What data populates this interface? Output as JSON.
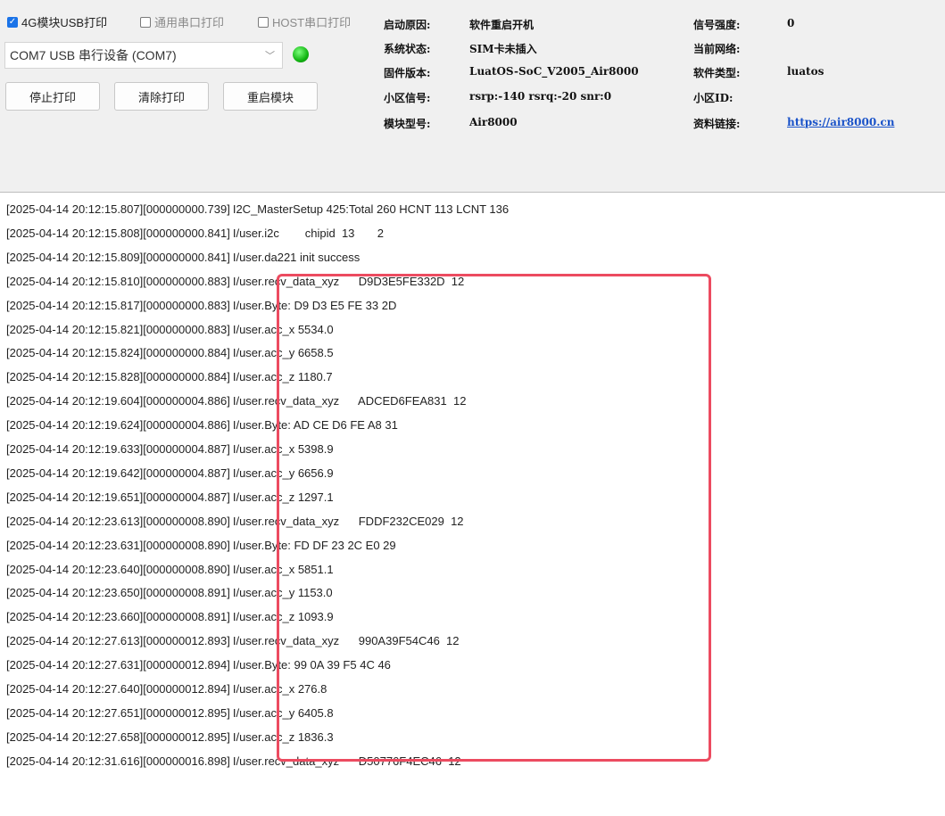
{
  "toolbar": {
    "checkbox_4g_usb": "4G模块USB打印",
    "checkbox_general_serial": "通用串口打印",
    "checkbox_host_serial": "HOST串口打印",
    "port_select": "COM7 USB 串行设备 (COM7)",
    "stop_button": "停止打印",
    "clear_button": "清除打印",
    "restart_button": "重启模块"
  },
  "device_info": {
    "boot_reason_label": "启动原因:",
    "boot_reason_value": "软件重启开机",
    "system_state_label": "系统状态:",
    "system_state_value": "SIM卡未插入",
    "firmware_label": "固件版本:",
    "firmware_value": "LuatOS-SoC_V2005_Air8000",
    "cell_signal_label": "小区信号:",
    "cell_signal_value": "rsrp:-140 rsrq:-20 snr:0",
    "module_model_label": "模块型号:",
    "module_model_value": "Air8000",
    "signal_strength_label": "信号强度:",
    "signal_strength_value": "0",
    "current_network_label": "当前网络:",
    "current_network_value": "",
    "software_type_label": "软件类型:",
    "software_type_value": "luatos",
    "cell_id_label": "小区ID:",
    "cell_id_value": "",
    "resource_link_label": "资料链接:",
    "resource_link_value": "https://air8000.cn"
  },
  "log": [
    {
      "prefix": "[2025-04-14 20:12:15.807][000000000.739]",
      "msg": "I2C_MasterSetup 425:Total 260 HCNT 113 LCNT 136"
    },
    {
      "prefix": "[2025-04-14 20:12:15.808][000000000.841]",
      "msg": "I/user.i2c        chipid  13       2"
    },
    {
      "prefix": "[2025-04-14 20:12:15.809][000000000.841]",
      "msg": "I/user.da221 init success"
    },
    {
      "prefix": "[2025-04-14 20:12:15.810][000000000.883]",
      "msg": "I/user.recv_data_xyz      D9D3E5FE332D  12"
    },
    {
      "prefix": "[2025-04-14 20:12:15.817][000000000.883]",
      "msg": "I/user.Byte: D9 D3 E5 FE 33 2D"
    },
    {
      "prefix": "[2025-04-14 20:12:15.821][000000000.883]",
      "msg": "I/user.acc_x 5534.0"
    },
    {
      "prefix": "[2025-04-14 20:12:15.824][000000000.884]",
      "msg": "I/user.acc_y 6658.5"
    },
    {
      "prefix": "[2025-04-14 20:12:15.828][000000000.884]",
      "msg": "I/user.acc_z 1180.7"
    },
    {
      "prefix": "[2025-04-14 20:12:19.604][000000004.886]",
      "msg": "I/user.recv_data_xyz      ADCED6FEA831  12"
    },
    {
      "prefix": "[2025-04-14 20:12:19.624][000000004.886]",
      "msg": "I/user.Byte: AD CE D6 FE A8 31"
    },
    {
      "prefix": "[2025-04-14 20:12:19.633][000000004.887]",
      "msg": "I/user.acc_x 5398.9"
    },
    {
      "prefix": "[2025-04-14 20:12:19.642][000000004.887]",
      "msg": "I/user.acc_y 6656.9"
    },
    {
      "prefix": "[2025-04-14 20:12:19.651][000000004.887]",
      "msg": "I/user.acc_z 1297.1"
    },
    {
      "prefix": "[2025-04-14 20:12:23.613][000000008.890]",
      "msg": "I/user.recv_data_xyz      FDDF232CE029  12"
    },
    {
      "prefix": "[2025-04-14 20:12:23.631][000000008.890]",
      "msg": "I/user.Byte: FD DF 23 2C E0 29"
    },
    {
      "prefix": "[2025-04-14 20:12:23.640][000000008.890]",
      "msg": "I/user.acc_x 5851.1"
    },
    {
      "prefix": "[2025-04-14 20:12:23.650][000000008.891]",
      "msg": "I/user.acc_y 1153.0"
    },
    {
      "prefix": "[2025-04-14 20:12:23.660][000000008.891]",
      "msg": "I/user.acc_z 1093.9"
    },
    {
      "prefix": "[2025-04-14 20:12:27.613][000000012.893]",
      "msg": "I/user.recv_data_xyz      990A39F54C46  12"
    },
    {
      "prefix": "[2025-04-14 20:12:27.631][000000012.894]",
      "msg": "I/user.Byte: 99 0A 39 F5 4C 46"
    },
    {
      "prefix": "[2025-04-14 20:12:27.640][000000012.894]",
      "msg": "I/user.acc_x 276.8"
    },
    {
      "prefix": "[2025-04-14 20:12:27.651][000000012.895]",
      "msg": "I/user.acc_y 6405.8"
    },
    {
      "prefix": "[2025-04-14 20:12:27.658][000000012.895]",
      "msg": "I/user.acc_z 1836.3"
    },
    {
      "prefix": "[2025-04-14 20:12:31.616][000000016.898]",
      "msg": "I/user.recv_data_xyz      D50776F4EC46  12"
    }
  ],
  "colors": {
    "highlight": "#ec4b60",
    "link": "#1a53c9",
    "led": "#12b512",
    "checkbox": "#1a73e8"
  }
}
